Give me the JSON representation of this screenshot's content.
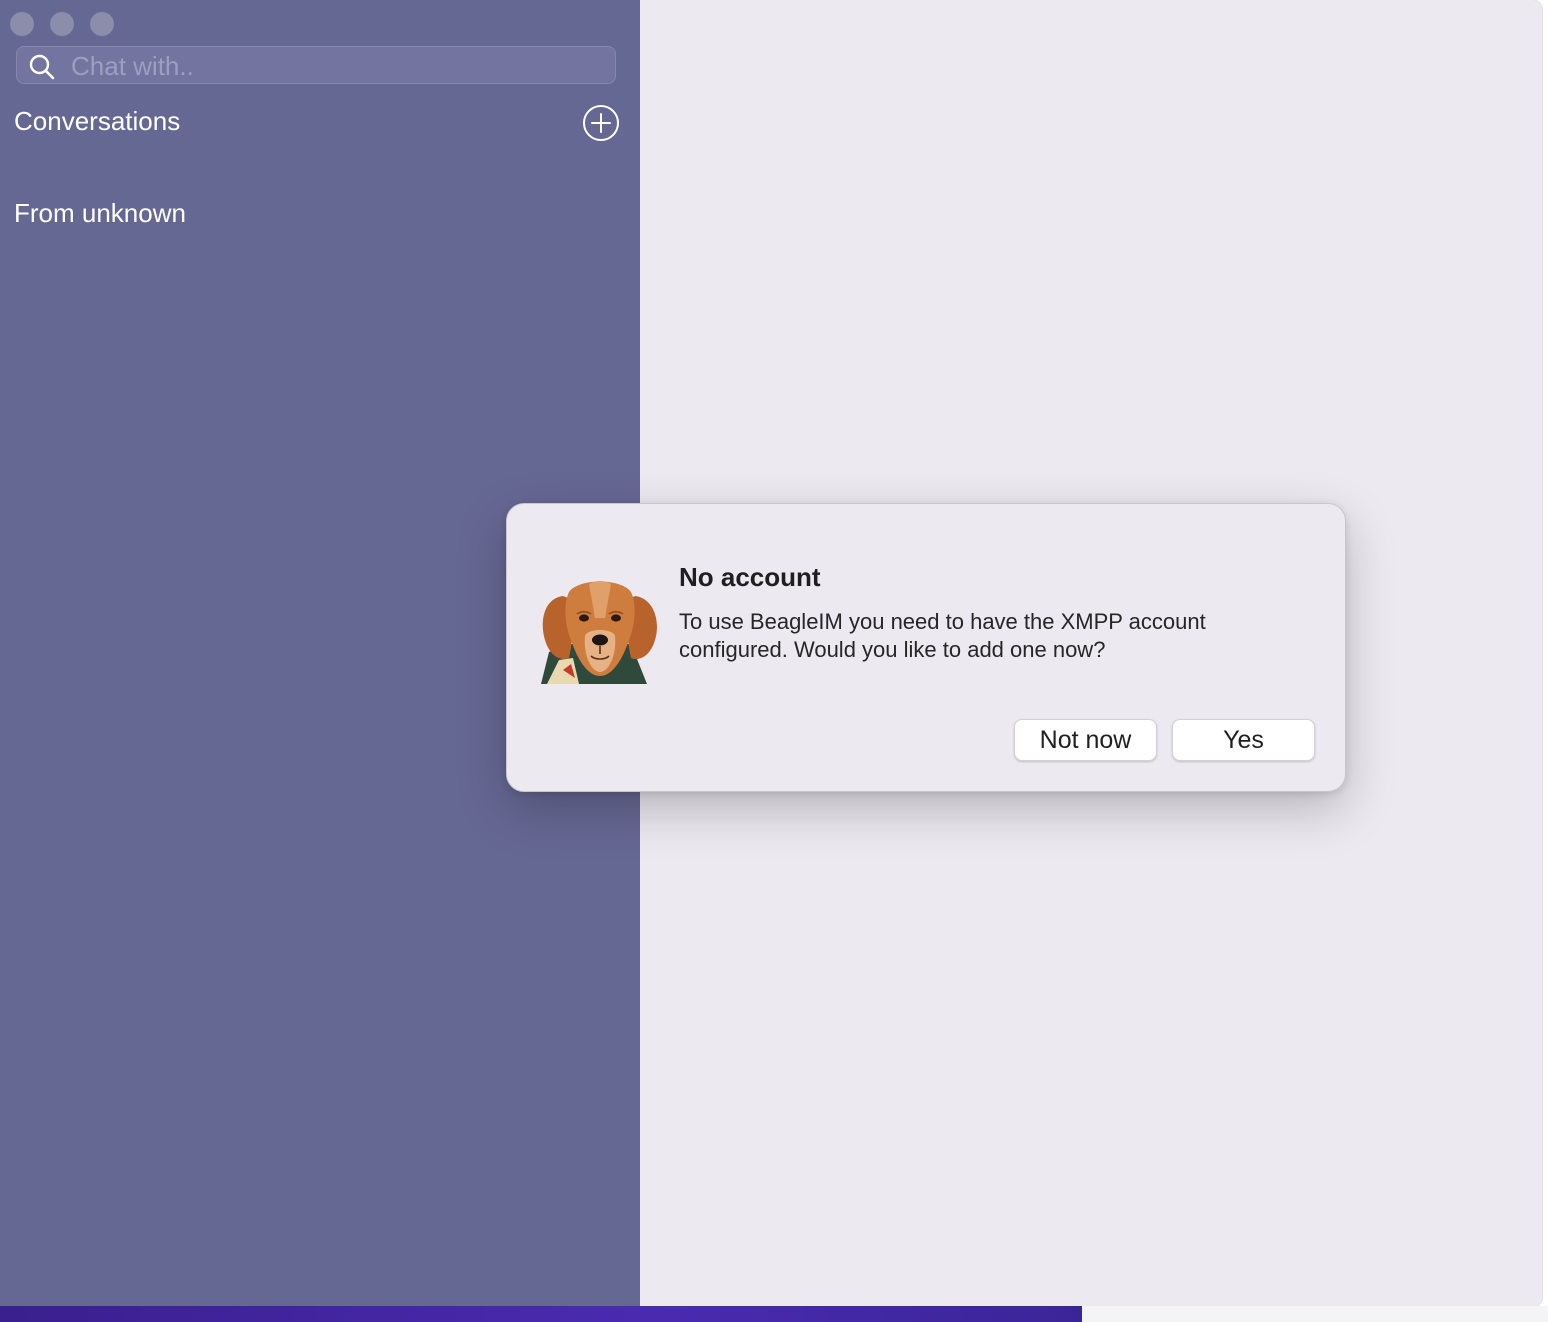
{
  "window": {
    "traffic_lights": [
      "close",
      "minimize",
      "zoom"
    ]
  },
  "sidebar": {
    "background": "#666894",
    "search": {
      "icon": "search-icon",
      "placeholder": "Chat with..",
      "value": ""
    },
    "conversations_label": "Conversations",
    "add_icon": "plus-circle-icon",
    "from_unknown_label": "From unknown"
  },
  "alert": {
    "icon": "beagle-dog-logo",
    "title": "No account",
    "message": "To use BeagleIM you need to have the XMPP account configured. Would you like to add one now?",
    "buttons": {
      "not_now": "Not now",
      "yes": "Yes"
    }
  },
  "colors": {
    "sidebar": "#666894",
    "content": "#ece9f1",
    "alert_background": "#ece9f1"
  }
}
